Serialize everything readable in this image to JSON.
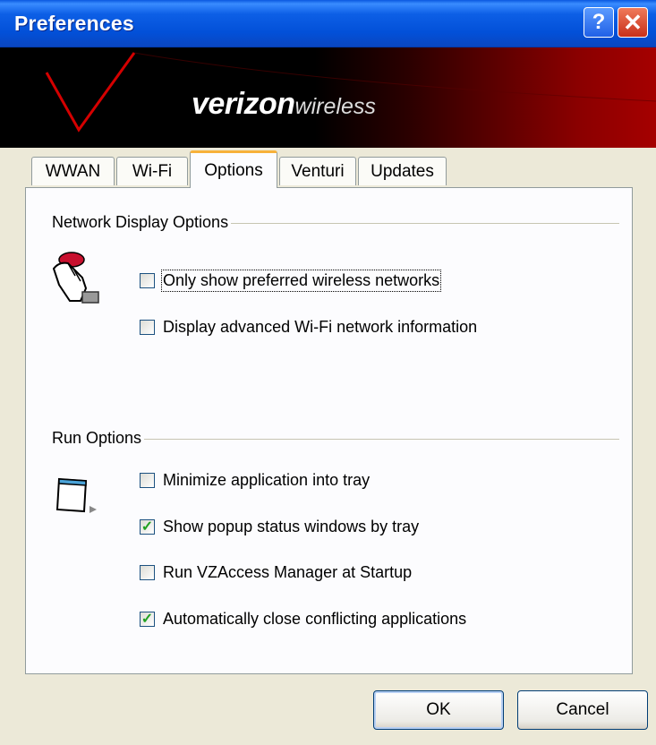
{
  "window": {
    "title": "Preferences",
    "help_label": "?",
    "close_label": "✕"
  },
  "banner": {
    "logo_text_1": "veri",
    "logo_text_2": "zon",
    "logo_text_3": "wireless",
    "accent_color": "#cc0000"
  },
  "tabs": [
    {
      "label": "WWAN",
      "active": false
    },
    {
      "label": "Wi-Fi",
      "active": false
    },
    {
      "label": "Options",
      "active": true
    },
    {
      "label": "Venturi",
      "active": false
    },
    {
      "label": "Updates",
      "active": false
    }
  ],
  "network_group": {
    "label": "Network Display Options",
    "icon": "hand-pointer-icon",
    "options": [
      {
        "label": "Only show preferred wireless networks",
        "checked": false
      },
      {
        "label": "Display advanced Wi-Fi network information",
        "checked": false
      }
    ]
  },
  "run_group": {
    "label": "Run Options",
    "icon": "window-tray-icon",
    "options": [
      {
        "label": "Minimize application into tray",
        "checked": false
      },
      {
        "label": "Show popup status windows by tray",
        "checked": true
      },
      {
        "label": "Run VZAccess Manager at Startup",
        "checked": false
      },
      {
        "label": "Automatically close conflicting applications",
        "checked": true
      }
    ]
  },
  "buttons": {
    "ok": "OK",
    "cancel": "Cancel"
  }
}
